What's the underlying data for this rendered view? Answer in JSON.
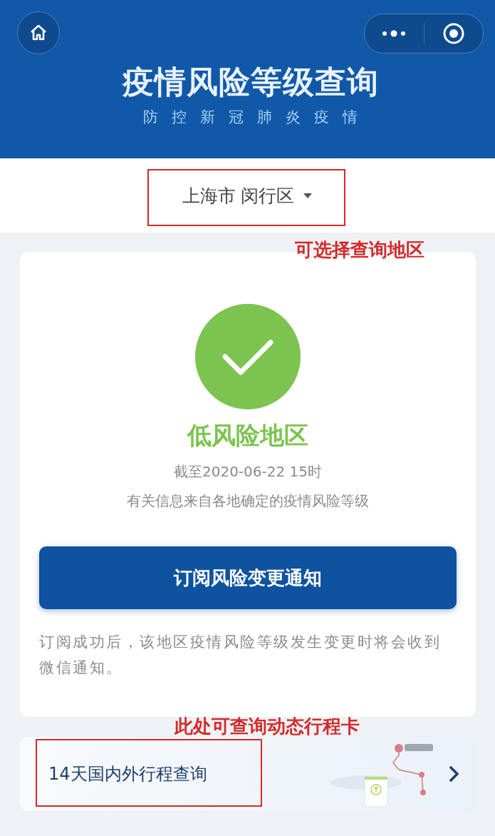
{
  "header": {
    "title": "疫情风险等级查询",
    "subtitle": "防控新冠肺炎疫情"
  },
  "location": {
    "label": "上海市 闵行区"
  },
  "result": {
    "kind": "low",
    "level": "低风险地区",
    "updated": "截至2020-06-22 15时",
    "source": "有关信息来自各地确定的疫情风险等级"
  },
  "subscribe_button": "订阅风险变更通知",
  "note": "订阅成功后，该地区疫情风险等级发生变更时将会收到微信通知。",
  "trip_card": {
    "label": "14天国内外行程查询"
  },
  "annotations": [
    {
      "kind": "location",
      "text": "可选择查询地区"
    },
    {
      "kind": "trip",
      "text": "此处可查询动态行程卡"
    }
  ]
}
